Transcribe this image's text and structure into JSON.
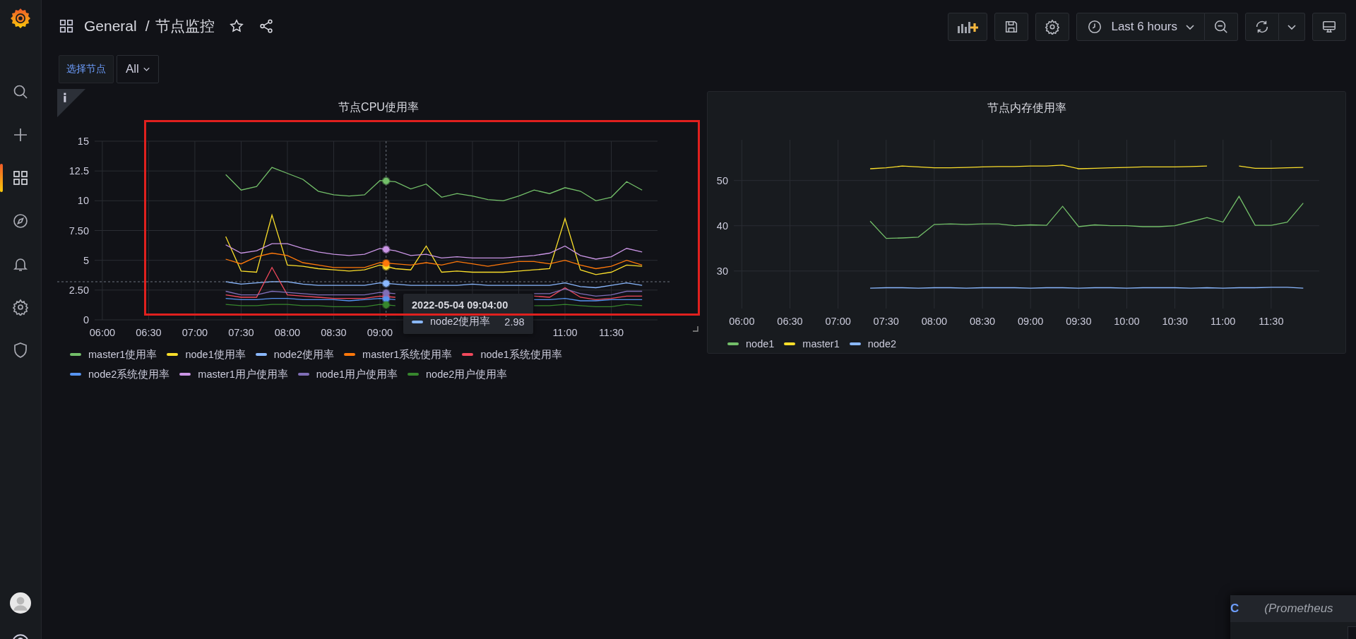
{
  "sidebar": {
    "items": [
      {
        "selected": false
      },
      {
        "selected": false
      },
      {
        "selected": true
      },
      {
        "selected": false
      },
      {
        "selected": false
      },
      {
        "selected": false
      },
      {
        "selected": false
      }
    ]
  },
  "breadcrumb": {
    "folder": "General",
    "separator": "/",
    "title": "节点监控"
  },
  "toolbar": {
    "time_range": "Last 6 hours"
  },
  "variables": [
    {
      "label": "选择节点",
      "value": "All"
    }
  ],
  "panels": [
    {
      "title": "节点CPU使用率",
      "tooltip": {
        "time": "2022-05-04 09:04:00",
        "series": "node2使用率",
        "value": "2.98",
        "color": "#8ab8ff"
      },
      "chart_data": {
        "type": "line",
        "categories": [
          "06:00",
          null,
          null,
          "06:30",
          null,
          null,
          "07:00",
          null,
          null,
          "07:30",
          null,
          null,
          "08:00",
          null,
          null,
          "08:30",
          null,
          null,
          "09:00",
          null,
          null,
          null,
          null,
          null,
          null,
          null,
          null,
          null,
          null,
          null,
          "11:00",
          null,
          null,
          "11:30",
          null,
          null
        ],
        "ylim": [
          0,
          15
        ],
        "grid": true,
        "ref_lines": [
          {
            "axis": "y",
            "value": 3.2
          }
        ],
        "yticks": [
          {
            "value": 0,
            "label": "0"
          },
          {
            "value": 2.5,
            "label": "2.50"
          },
          {
            "value": 5,
            "label": "5"
          },
          {
            "value": 7.5,
            "label": "7.50"
          },
          {
            "value": 10,
            "label": "10"
          },
          {
            "value": 12.5,
            "label": "12.5"
          },
          {
            "value": 15,
            "label": "15"
          }
        ],
        "series": [
          {
            "name": "master1使用率",
            "color": "#73bf69",
            "values": [
              null,
              null,
              null,
              null,
              null,
              null,
              null,
              null,
              12.2,
              10.9,
              11.2,
              12.8,
              12.3,
              11.8,
              10.8,
              10.5,
              10.4,
              10.5,
              11.7,
              11.6,
              11.0,
              11.4,
              10.3,
              10.6,
              10.4,
              10.1,
              10.0,
              10.4,
              10.9,
              10.6,
              11.1,
              10.8,
              10.0,
              10.3,
              11.6,
              10.9
            ]
          },
          {
            "name": "node1使用率",
            "color": "#fade2a",
            "values": [
              null,
              null,
              null,
              null,
              null,
              null,
              null,
              null,
              7.0,
              4.1,
              4.0,
              8.8,
              4.6,
              4.5,
              4.3,
              4.2,
              4.1,
              4.2,
              4.6,
              4.3,
              4.2,
              6.2,
              4.0,
              4.1,
              4.0,
              4.0,
              4.0,
              4.1,
              4.2,
              4.3,
              8.5,
              4.2,
              3.8,
              4.0,
              4.6,
              4.5
            ]
          },
          {
            "name": "node2使用率",
            "color": "#8ab8ff",
            "values": [
              null,
              null,
              null,
              null,
              null,
              null,
              null,
              null,
              3.2,
              3.0,
              3.1,
              3.2,
              3.2,
              3.0,
              2.9,
              2.9,
              2.9,
              2.9,
              3.1,
              3.0,
              2.9,
              2.9,
              2.9,
              2.9,
              3.0,
              2.9,
              2.9,
              2.9,
              2.9,
              2.9,
              3.1,
              2.8,
              2.7,
              2.9,
              3.1,
              2.9
            ]
          },
          {
            "name": "master1系统使用率",
            "color": "#ff780a",
            "values": [
              null,
              null,
              null,
              null,
              null,
              null,
              null,
              null,
              5.1,
              4.7,
              5.3,
              5.6,
              5.4,
              4.8,
              4.6,
              4.4,
              4.4,
              4.4,
              4.8,
              4.7,
              4.6,
              4.8,
              4.6,
              4.9,
              4.7,
              4.5,
              4.7,
              4.9,
              4.9,
              4.7,
              5.0,
              4.6,
              4.3,
              4.5,
              5.0,
              4.6
            ]
          },
          {
            "name": "node1系统使用率",
            "color": "#f2495c",
            "values": [
              null,
              null,
              null,
              null,
              null,
              null,
              null,
              null,
              2.1,
              1.9,
              1.9,
              4.4,
              2.1,
              2.0,
              1.9,
              1.8,
              1.8,
              1.8,
              2.0,
              1.9,
              null,
              null,
              null,
              null,
              null,
              null,
              null,
              null,
              2.0,
              1.9,
              2.7,
              1.9,
              1.7,
              1.8,
              2.0,
              2.0
            ]
          },
          {
            "name": "node2系统使用率",
            "color": "#5794f2",
            "values": [
              null,
              null,
              null,
              null,
              null,
              null,
              null,
              null,
              1.8,
              1.7,
              1.7,
              1.8,
              1.8,
              1.7,
              1.7,
              1.7,
              1.6,
              1.7,
              1.8,
              1.7,
              null,
              null,
              null,
              null,
              null,
              null,
              null,
              null,
              1.7,
              1.7,
              1.8,
              1.6,
              1.6,
              1.7,
              1.7,
              1.7
            ]
          },
          {
            "name": "master1用户使用率",
            "color": "#ca95e5",
            "values": [
              null,
              null,
              null,
              null,
              null,
              null,
              null,
              null,
              6.3,
              5.6,
              5.8,
              6.4,
              6.4,
              6.0,
              5.7,
              5.5,
              5.4,
              5.5,
              6.0,
              5.8,
              5.4,
              5.5,
              5.2,
              5.3,
              5.2,
              5.2,
              5.2,
              5.3,
              5.4,
              5.6,
              6.2,
              5.4,
              5.1,
              5.3,
              6.0,
              5.7
            ]
          },
          {
            "name": "node1用户使用率",
            "color": "#806eb7",
            "values": [
              null,
              null,
              null,
              null,
              null,
              null,
              null,
              null,
              2.4,
              2.1,
              2.1,
              2.4,
              2.3,
              2.2,
              2.1,
              2.1,
              2.1,
              2.1,
              2.3,
              2.2,
              null,
              null,
              null,
              null,
              null,
              null,
              null,
              null,
              2.2,
              2.2,
              2.6,
              2.2,
              2.0,
              2.1,
              2.4,
              2.4
            ]
          },
          {
            "name": "node2用户使用率",
            "color": "#37872d",
            "values": [
              null,
              null,
              null,
              null,
              null,
              null,
              null,
              null,
              1.3,
              1.2,
              1.2,
              1.3,
              1.3,
              1.2,
              1.2,
              1.1,
              1.1,
              1.1,
              1.3,
              1.2,
              null,
              null,
              null,
              null,
              null,
              null,
              null,
              null,
              1.2,
              1.2,
              1.3,
              1.2,
              1.1,
              1.1,
              1.3,
              1.2
            ]
          }
        ]
      }
    },
    {
      "title": "节点内存使用率",
      "chart_data": {
        "type": "line",
        "categories": [
          "06:00",
          null,
          null,
          "06:30",
          null,
          null,
          "07:00",
          null,
          null,
          "07:30",
          null,
          null,
          "08:00",
          null,
          null,
          "08:30",
          null,
          null,
          "09:00",
          null,
          null,
          "09:30",
          null,
          null,
          "10:00",
          null,
          null,
          "10:30",
          null,
          null,
          "11:00",
          null,
          null,
          "11:30",
          null,
          null
        ],
        "ylim": [
          21.7,
          59
        ],
        "grid": true,
        "yticks": [
          30,
          40,
          50
        ],
        "series": [
          {
            "name": "node1",
            "color": "#73bf69",
            "values": [
              null,
              null,
              null,
              null,
              null,
              null,
              null,
              null,
              41,
              37.2,
              37.3,
              37.5,
              40.3,
              40.4,
              40.3,
              40.4,
              40.4,
              40.0,
              40.2,
              40.1,
              44.3,
              39.8,
              40.2,
              40.0,
              40.0,
              39.8,
              39.8,
              40.0,
              40.9,
              41.8,
              40.8,
              46.5,
              40.1,
              40.1,
              40.8,
              45.0
            ]
          },
          {
            "name": "master1",
            "color": "#fade2a",
            "values": [
              null,
              null,
              null,
              null,
              null,
              null,
              null,
              null,
              52.6,
              52.8,
              53.2,
              53.0,
              52.8,
              52.8,
              52.9,
              53.0,
              53.1,
              53.1,
              53.2,
              53.2,
              53.4,
              52.6,
              52.7,
              52.8,
              52.9,
              53.0,
              53.0,
              53.0,
              53.1,
              53.2,
              null,
              53.2,
              52.7,
              52.7,
              52.8,
              52.9
            ]
          },
          {
            "name": "node2",
            "color": "#8ab8ff",
            "values": [
              null,
              null,
              null,
              null,
              null,
              null,
              null,
              null,
              26.2,
              26.3,
              26.3,
              26.2,
              26.3,
              26.3,
              26.2,
              26.3,
              26.3,
              26.3,
              26.2,
              26.3,
              26.3,
              26.2,
              26.3,
              26.3,
              26.2,
              26.3,
              26.3,
              26.3,
              26.2,
              26.3,
              26.2,
              26.3,
              26.3,
              26.4,
              26.4,
              26.2
            ]
          }
        ]
      }
    }
  ],
  "popup": {
    "letter": "C",
    "text": "(Prometheus"
  }
}
